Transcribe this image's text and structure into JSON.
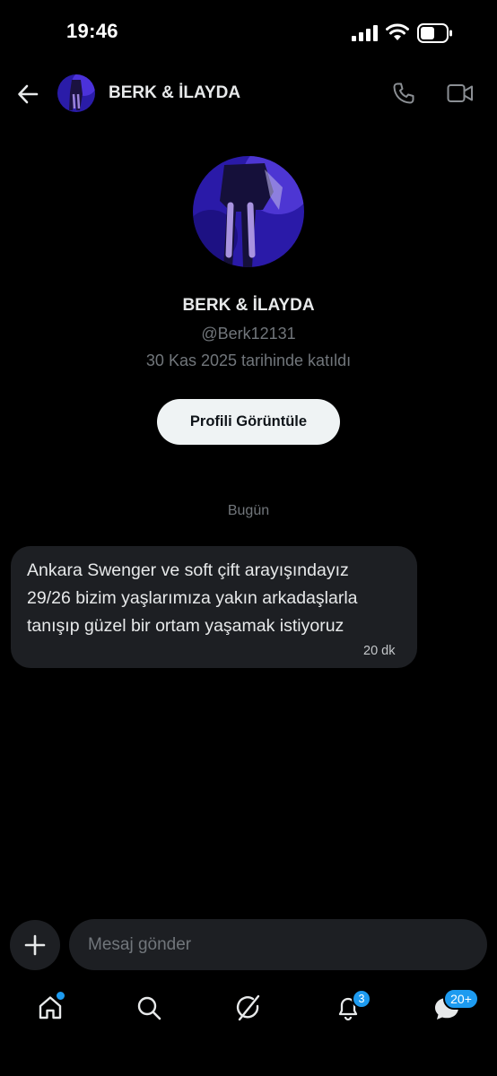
{
  "status_bar": {
    "time": "19:46"
  },
  "header": {
    "title": "BERK & İLAYDA"
  },
  "profile": {
    "name": "BERK & İLAYDA",
    "handle": "@Berk12131",
    "joined": "30 Kas 2025 tarihinde katıldı",
    "view_button": "Profili Görüntüle"
  },
  "conversation": {
    "date_separator": "Bugün",
    "messages": [
      {
        "lines": [
          "Ankara Swenger ve soft çift arayışındayız",
          "29/26 bizim yaşlarımıza yakın arkadaşlarla",
          "tanışıp güzel bir ortam yaşamak istiyoruz"
        ],
        "time": "20 dk"
      }
    ]
  },
  "composer": {
    "placeholder": "Mesaj gönder"
  },
  "nav": {
    "items": [
      "home-icon",
      "search-icon",
      "grok-icon",
      "bell-icon",
      "messages-icon"
    ],
    "notifications_badge": "3",
    "messages_badge": "20+"
  },
  "colors": {
    "accent": "#1d9bf0",
    "background": "#000000",
    "bubble": "#1d1f23"
  }
}
